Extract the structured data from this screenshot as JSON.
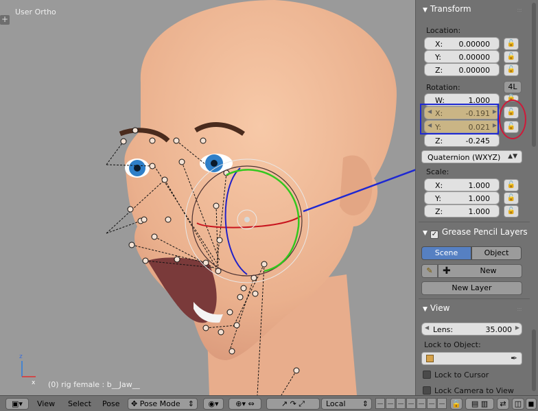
{
  "viewport": {
    "title": "User Ortho",
    "status": "(0) rig female : b__Jaw__",
    "axis_x": "x",
    "axis_z": "z",
    "plus": "+"
  },
  "transform": {
    "header": "Transform",
    "location_label": "Location:",
    "location": [
      {
        "axis": "X:",
        "value": "0.00000"
      },
      {
        "axis": "Y:",
        "value": "0.00000"
      },
      {
        "axis": "Z:",
        "value": "0.00000"
      }
    ],
    "rotation_label": "Rotation:",
    "rotation_mode_button": "4L",
    "rotation": [
      {
        "axis": "W:",
        "value": "1.000"
      },
      {
        "axis": "X:",
        "value": "-0.191"
      },
      {
        "axis": "Y:",
        "value": "0.021"
      },
      {
        "axis": "Z:",
        "value": "-0.245"
      }
    ],
    "rotation_mode": "Quaternion (WXYZ)",
    "scale_label": "Scale:",
    "scale": [
      {
        "axis": "X:",
        "value": "1.000"
      },
      {
        "axis": "Y:",
        "value": "1.000"
      },
      {
        "axis": "Z:",
        "value": "1.000"
      }
    ]
  },
  "grease_pencil": {
    "header": "Grease Pencil Layers",
    "tab_scene": "Scene",
    "tab_object": "Object",
    "new_label": "New",
    "new_layer_label": "New Layer"
  },
  "view": {
    "header": "View",
    "lens_label": "Lens:",
    "lens_value": "35.000",
    "lock_to_object_label": "Lock to Object:",
    "lock_to_cursor": "Lock to Cursor",
    "lock_camera_to_view": "Lock Camera to View"
  },
  "header_bar": {
    "menu_view": "View",
    "menu_select": "Select",
    "menu_pose": "Pose",
    "mode": "Pose Mode",
    "orientation": "Local"
  },
  "colors": {
    "annotation_blue": "#1e28d2",
    "annotation_red": "#d01838",
    "highlight_field": "#cab585"
  }
}
